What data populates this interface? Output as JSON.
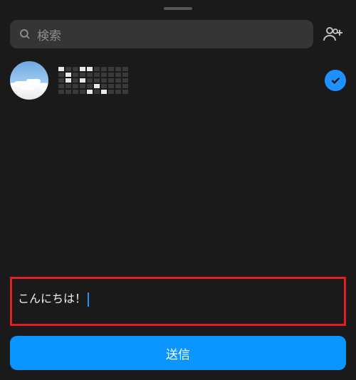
{
  "search": {
    "placeholder": "検索"
  },
  "contacts": [
    {
      "name_redacted": true,
      "selected": true
    }
  ],
  "message": {
    "input_value": "こんにちは！"
  },
  "buttons": {
    "send_label": "送信"
  },
  "colors": {
    "accent": "#0a95ff",
    "highlight_border": "#e21f1f"
  }
}
